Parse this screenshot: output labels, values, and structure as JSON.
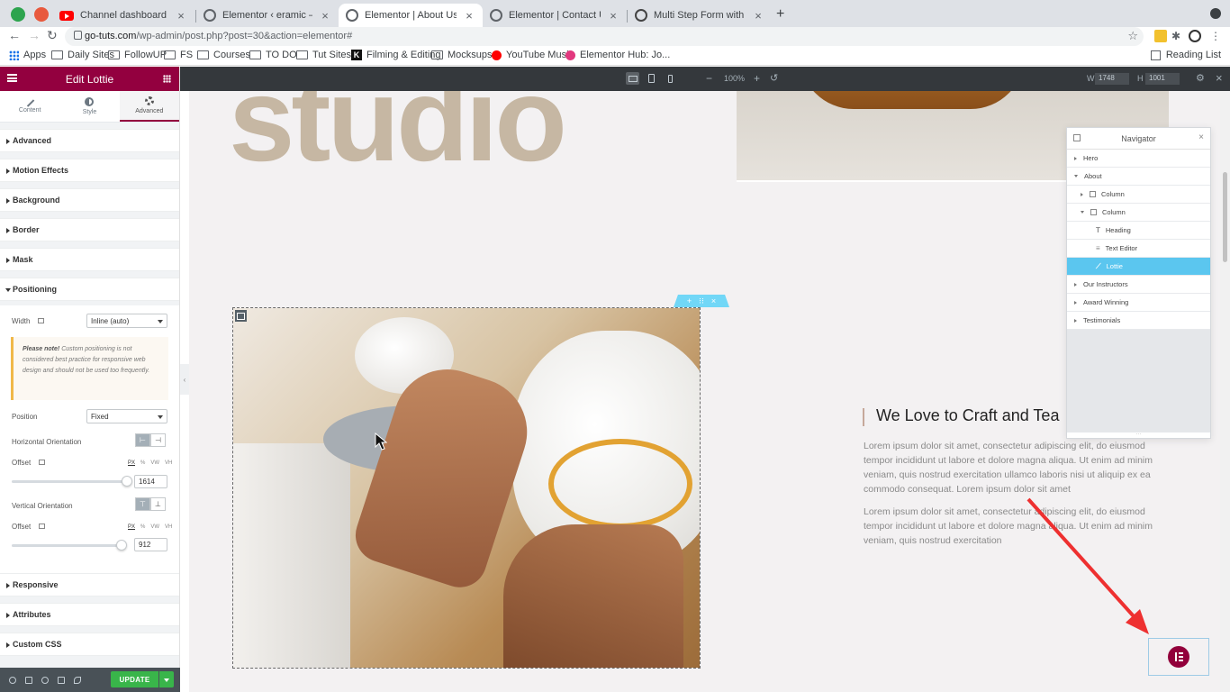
{
  "browser": {
    "tabs": [
      {
        "label": "Channel dashboard - YouTube",
        "icon": "youtube-favicon"
      },
      {
        "label": "Elementor ‹ eramic — WordPress",
        "icon": "globe-favicon"
      },
      {
        "label": "Elementor | About Us",
        "icon": "globe-favicon",
        "active": true
      },
      {
        "label": "Elementor | Contact Us",
        "icon": "globe-favicon"
      },
      {
        "label": "Multi Step Form with Progress",
        "icon": "webflow-favicon"
      }
    ],
    "url_host": "go-tuts.com",
    "url_path": "/wp-admin/post.php?post=30&action=elementor#",
    "bookmarks": [
      "Apps",
      "Daily Sites",
      "FollowUP",
      "FS",
      "Courses",
      "TO DO",
      "Tut Sites",
      "Filming & Editing",
      "Mocksups",
      "YouTube Music",
      "Elementor Hub: Jo..."
    ],
    "reading_list": "Reading List"
  },
  "panel": {
    "title": "Edit Lottie",
    "tabs": {
      "content": "Content",
      "style": "Style",
      "advanced": "Advanced"
    },
    "sections": {
      "advanced": "Advanced",
      "motion": "Motion Effects",
      "background": "Background",
      "border": "Border",
      "mask": "Mask",
      "positioning": "Positioning",
      "responsive": "Responsive",
      "attributes": "Attributes",
      "custom_css": "Custom CSS"
    },
    "positioning": {
      "width_label": "Width",
      "width_value": "Inline (auto)",
      "note_bold": "Please note!",
      "note_text": " Custom positioning is not considered best practice for responsive web design and should not be used too frequently.",
      "position_label": "Position",
      "position_value": "Fixed",
      "h_orientation_label": "Horizontal Orientation",
      "offset_label": "Offset",
      "h_offset_value": "1614",
      "v_orientation_label": "Vertical Orientation",
      "v_offset_value": "912",
      "units": [
        "PX",
        "%",
        "VW",
        "VH"
      ]
    },
    "update_label": "UPDATE"
  },
  "editor_bar": {
    "zoom": "100%",
    "width_label": "W",
    "width_value": "1748",
    "height_label": "H",
    "height_value": "1001"
  },
  "canvas": {
    "hero_word": "studio",
    "heading": "We Love to Craft and Tea",
    "paragraph1": "Lorem ipsum dolor sit amet, consectetur adipiscing elit, do eiusmod tempor incididunt ut labore et dolore magna aliqua. Ut enim ad minim veniam, quis nostrud exercitation ullamco laboris nisi ut aliquip ex ea commodo consequat. Lorem ipsum dolor sit amet",
    "paragraph2": "Lorem ipsum dolor sit amet, consectetur adipiscing elit, do eiusmod tempor incididunt ut labore et dolore magna aliqua. Ut enim ad minim veniam, quis nostrud exercitation"
  },
  "navigator": {
    "title": "Navigator",
    "items": [
      {
        "label": "Hero"
      },
      {
        "label": "About"
      },
      {
        "label": "Column"
      },
      {
        "label": "Column"
      },
      {
        "label": "Heading"
      },
      {
        "label": "Text Editor"
      },
      {
        "label": "Lottie"
      },
      {
        "label": "Our Instructors"
      },
      {
        "label": "Award Winning"
      },
      {
        "label": "Testimonials"
      }
    ]
  },
  "colors": {
    "elementor_brand": "#93003f",
    "selection": "#5bc6ef",
    "update_green": "#39b54a",
    "hero_text": "#c6b7a3",
    "annotation_arrow": "#ee3030"
  }
}
